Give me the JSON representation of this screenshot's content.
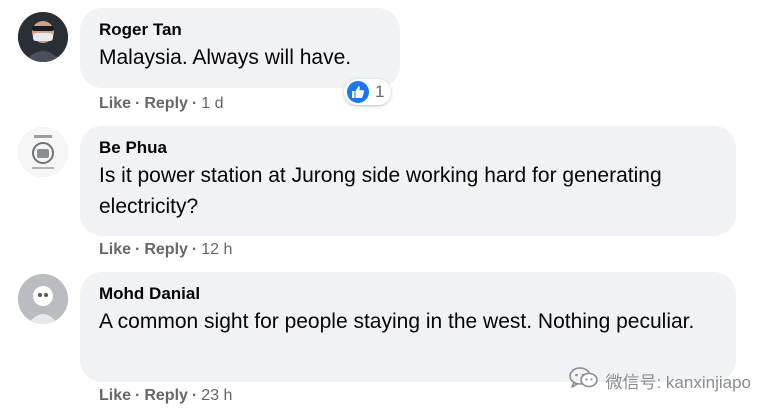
{
  "comments": [
    {
      "author": "Roger Tan",
      "text": "Malaysia. Always will have.",
      "like_label": "Like",
      "reply_label": "Reply",
      "separator": "·",
      "time": "1 d",
      "reaction_count": "1"
    },
    {
      "author": "Be Phua",
      "text": "Is it power station at Jurong side working hard for generating electricity?",
      "like_label": "Like",
      "reply_label": "Reply",
      "separator": "·",
      "time": "12 h"
    },
    {
      "author": "Mohd Danial",
      "text": "A common sight for people staying in the west. Nothing peculiar.",
      "like_label": "Like",
      "reply_label": "Reply",
      "separator": "·",
      "time": "23 h"
    }
  ],
  "watermark": {
    "text": "微信号: kanxinjiapo",
    "icon": "wechat-icon"
  },
  "colors": {
    "bubble": "#f0f2f5",
    "like_blue": "#1877f2",
    "secondary_text": "#65676b"
  }
}
